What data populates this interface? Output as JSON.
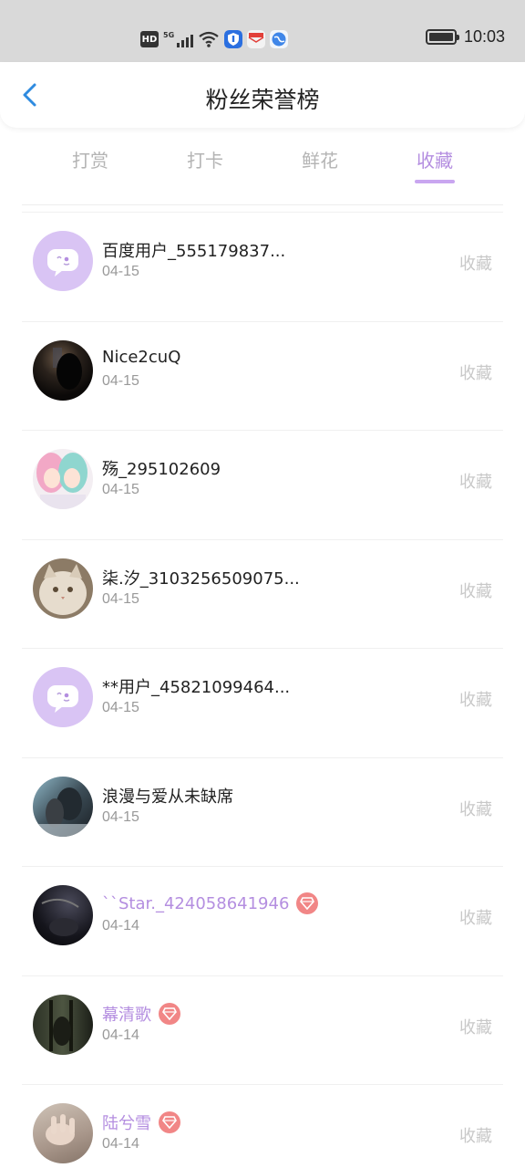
{
  "status_bar": {
    "hd": "HD",
    "network": "5G",
    "time": "10:03"
  },
  "header": {
    "title": "粉丝荣誉榜",
    "back_icon": "chevron-left-icon"
  },
  "tabs": [
    {
      "label": "打赏",
      "active": false
    },
    {
      "label": "打卡",
      "active": false
    },
    {
      "label": "鲜花",
      "active": false
    },
    {
      "label": "收藏",
      "active": true
    }
  ],
  "colors": {
    "accent": "#b48ee0",
    "vip_badge": "#f18686",
    "inactive_tab": "#b4b4b4"
  },
  "fans": [
    {
      "name": "百度用户_555179837...",
      "date": "04-15",
      "action": "收藏",
      "vip": false,
      "avatar": "default-chat-avatar"
    },
    {
      "name": "Nice2cuQ",
      "date": "04-15",
      "action": "收藏",
      "vip": false,
      "avatar": "dark-photo-avatar"
    },
    {
      "name": "殇_295102609",
      "date": "04-15",
      "action": "收藏",
      "vip": false,
      "avatar": "anime-girls-avatar"
    },
    {
      "name": "柒.汐_3103256509075...",
      "date": "04-15",
      "action": "收藏",
      "vip": false,
      "avatar": "cat-avatar"
    },
    {
      "name": "**用户_45821099464...",
      "date": "04-15",
      "action": "收藏",
      "vip": false,
      "avatar": "default-chat-avatar"
    },
    {
      "name": "浪漫与爱从未缺席",
      "date": "04-15",
      "action": "收藏",
      "vip": false,
      "avatar": "couple-photo-avatar"
    },
    {
      "name": "``Star._424058641946",
      "date": "04-14",
      "action": "收藏",
      "vip": true,
      "avatar": "dark-night-avatar"
    },
    {
      "name": "幕清歌",
      "date": "04-14",
      "action": "收藏",
      "vip": true,
      "avatar": "dark-room-avatar"
    },
    {
      "name": "陆兮雪",
      "date": "04-14",
      "action": "收藏",
      "vip": true,
      "avatar": "hand-photo-avatar"
    }
  ]
}
